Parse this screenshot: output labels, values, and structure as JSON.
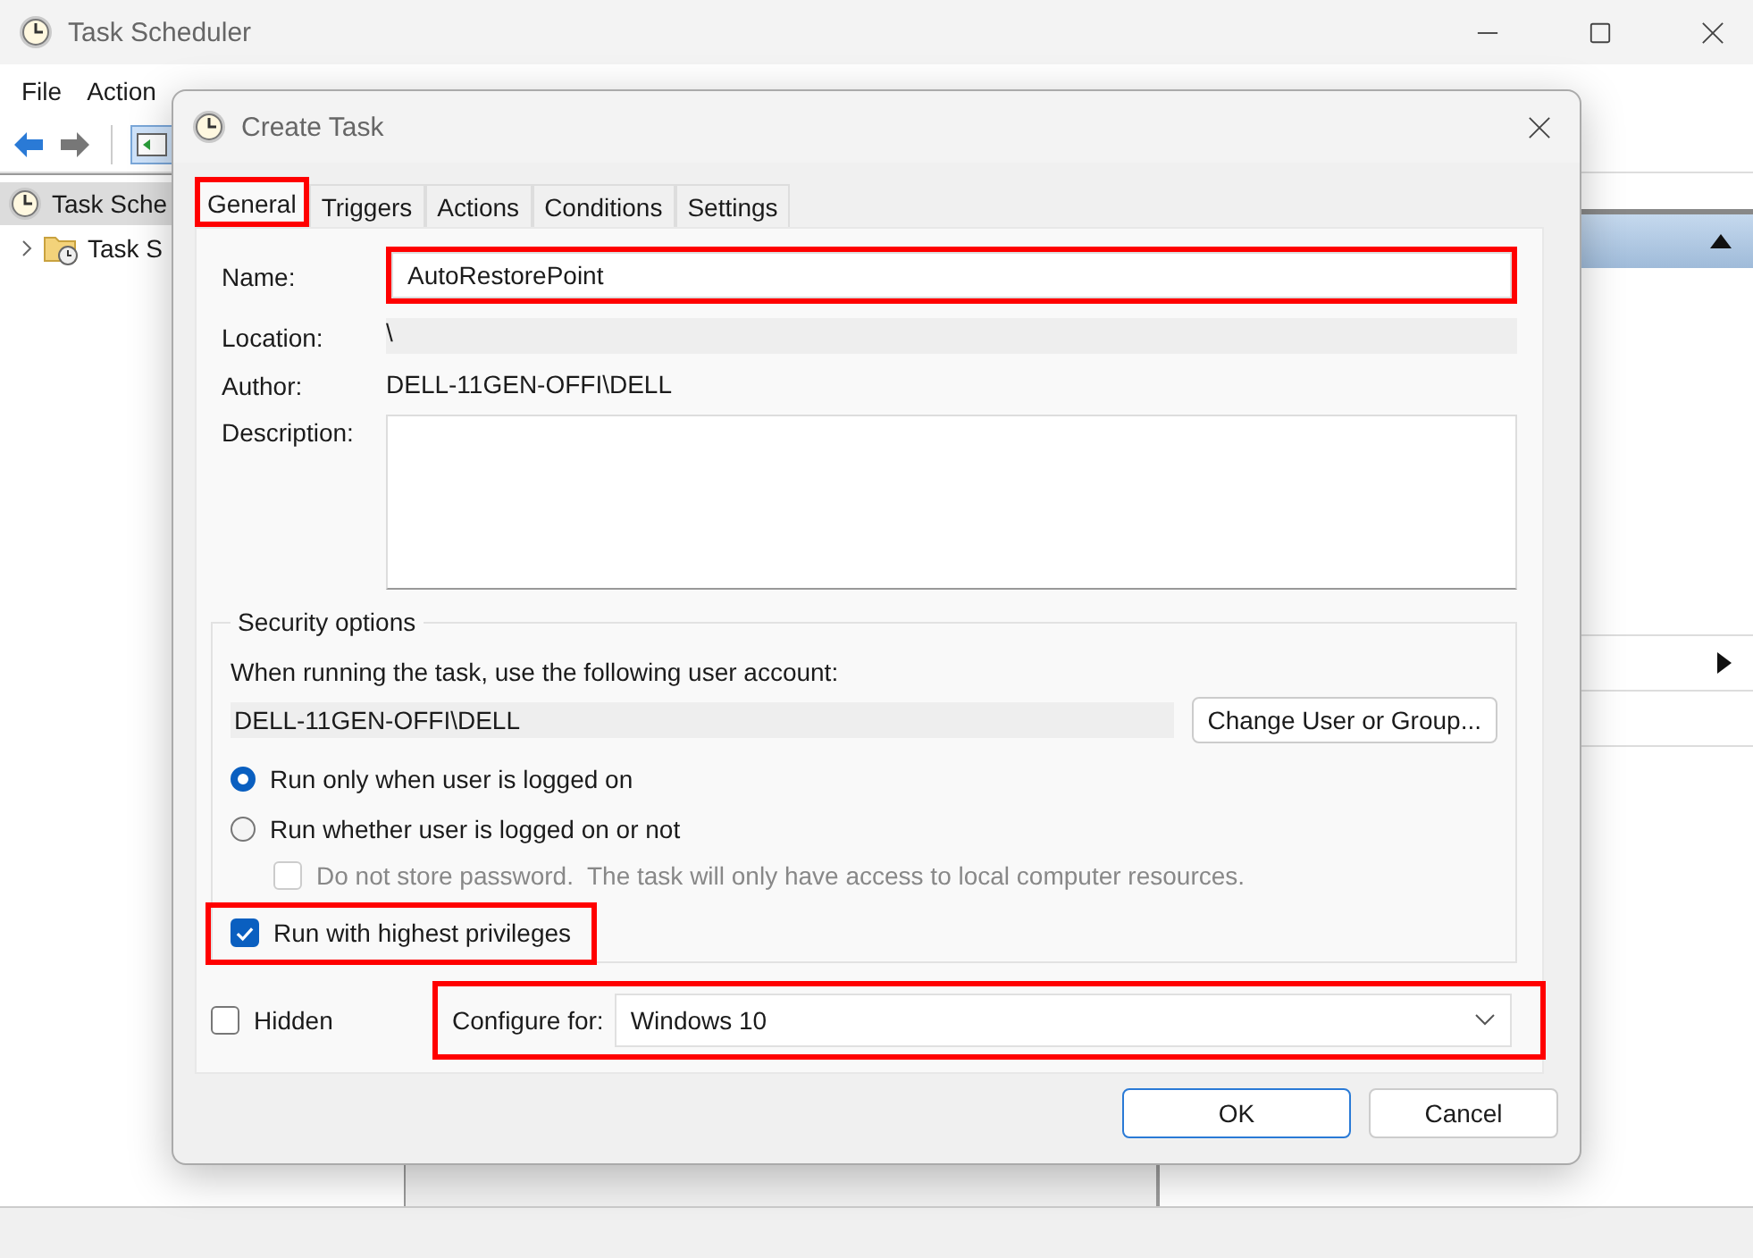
{
  "window": {
    "title": "Task Scheduler"
  },
  "menu": [
    {
      "label": "File"
    },
    {
      "label": "Action"
    }
  ],
  "tree": [
    {
      "label": "Task Sche",
      "selected": true,
      "children": [
        {
          "label": "Task S",
          "selected": false,
          "expanded": false
        }
      ]
    }
  ],
  "dialog": {
    "title": "Create Task",
    "tabs": [
      {
        "label": "General",
        "selected": true,
        "highlighted": true
      },
      {
        "label": "Triggers",
        "selected": false,
        "highlighted": false
      },
      {
        "label": "Actions",
        "selected": false,
        "highlighted": false
      },
      {
        "label": "Conditions",
        "selected": false,
        "highlighted": false
      },
      {
        "label": "Settings",
        "selected": false,
        "highlighted": false
      }
    ],
    "name": {
      "label": "Name:",
      "value": "AutoRestorePoint",
      "highlighted": true
    },
    "location": {
      "label": "Location:",
      "value": "\\"
    },
    "author": {
      "label": "Author:",
      "value": "DELL-11GEN-OFFI\\DELL"
    },
    "description": {
      "label": "Description:"
    },
    "security": {
      "title": "Security options",
      "account_label": "When running the task, use the following user account:",
      "account_value": "DELL-11GEN-OFFI\\DELL",
      "change_button": "Change User or Group...",
      "options": [
        {
          "kind": "radio",
          "label": "Run only when user is logged on",
          "selected": true,
          "highlighted": false
        },
        {
          "kind": "radio",
          "label": "Run whether user is logged on or not",
          "selected": false,
          "highlighted": false
        },
        {
          "kind": "sub-checkbox",
          "label": "Do not store password.  The task will only have access to local computer resources.",
          "checked": false,
          "highlighted": false
        },
        {
          "kind": "checkbox",
          "label": "Run with highest privileges",
          "checked": true,
          "highlighted": true
        }
      ]
    },
    "hidden": {
      "label": "Hidden",
      "checked": false
    },
    "configure": {
      "label": "Configure for:",
      "value": "Windows 10",
      "highlighted": true
    },
    "buttons": [
      {
        "label": "OK",
        "default": true
      },
      {
        "label": "Cancel",
        "default": false
      }
    ]
  }
}
